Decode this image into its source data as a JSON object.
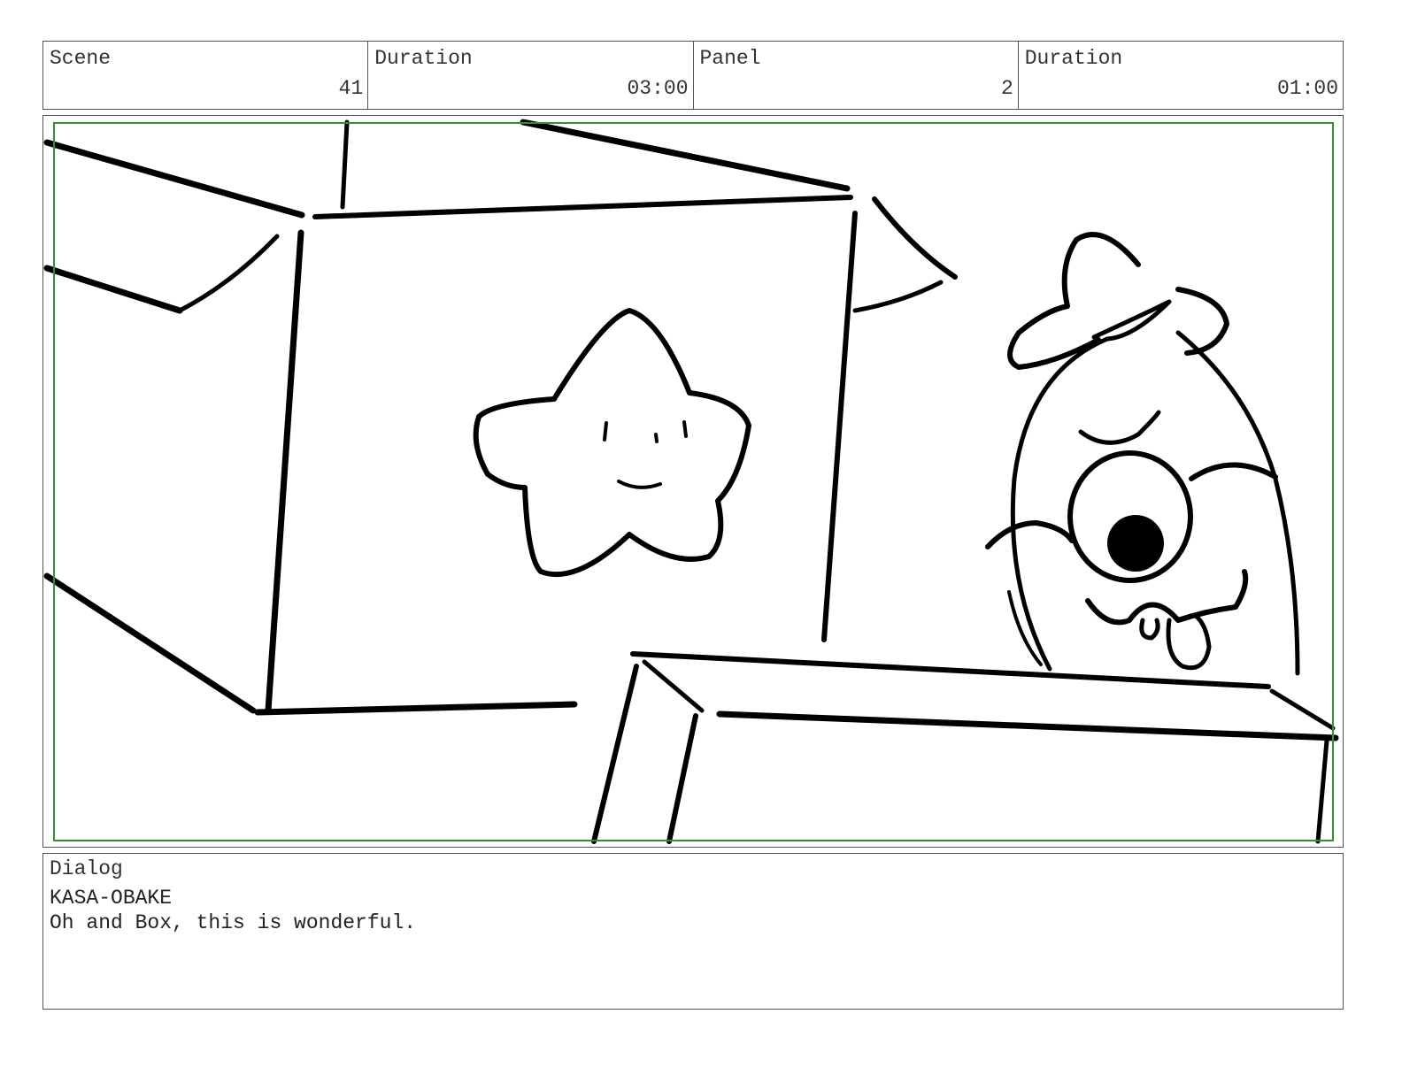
{
  "header": {
    "cells": [
      {
        "label": "Scene",
        "value": "41"
      },
      {
        "label": "Duration",
        "value": "03:00"
      },
      {
        "label": "Panel",
        "value": "2"
      },
      {
        "label": "Duration",
        "value": "01:00"
      }
    ]
  },
  "panel": {
    "safe_area_color": "#3a8a3a",
    "sketch_elements": [
      "cardboard-box-with-star",
      "kasa-obake-character",
      "foreground-box"
    ]
  },
  "dialog": {
    "label": "Dialog",
    "speaker": "KASA-OBAKE",
    "line": "Oh and Box, this is wonderful."
  }
}
